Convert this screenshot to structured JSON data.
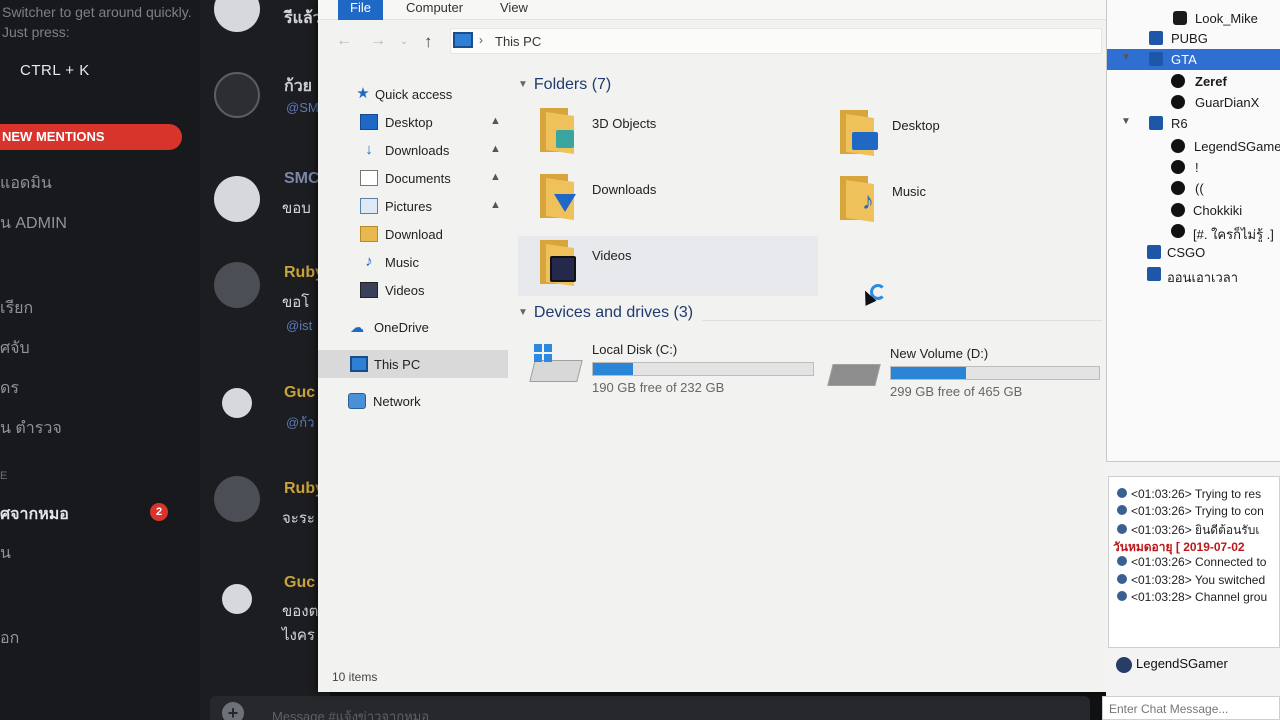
{
  "chat_app": {
    "hint": "Switcher to get around quickly. Just press:",
    "shortcut": "CTRL + K",
    "mentions_label": "NEW MENTIONS",
    "channels": [
      {
        "label": "แอดมิน",
        "bold": false
      },
      {
        "label": "น ADMIN",
        "bold": false
      },
      {
        "label": "เรียก",
        "bold": false
      },
      {
        "label": "ศจับ",
        "bold": false
      },
      {
        "label": "ดร",
        "bold": false
      },
      {
        "label": "น ตำรวจ",
        "bold": false
      },
      {
        "label": "E",
        "bold": false
      },
      {
        "label": "ศจากหมอ",
        "bold": true
      },
      {
        "label": "น",
        "bold": false
      },
      {
        "label": "อก",
        "bold": false
      }
    ],
    "unread_badge": "2",
    "messages": [
      {
        "name": "รีแล้ว",
        "text": "",
        "sub": ""
      },
      {
        "name": "ก้วย",
        "text": "",
        "sub": "@SM"
      },
      {
        "name": "SMC",
        "text": "ขอบ",
        "sub": ""
      },
      {
        "name": "Ruby",
        "text": "ขอโ",
        "sub": "@ist"
      },
      {
        "name": "Guc",
        "text": "",
        "sub": "@ก้ว"
      },
      {
        "name": "Ruby",
        "text": "จะระ",
        "sub": ""
      },
      {
        "name": "Guc",
        "text": "ของต ไงคร",
        "sub": ""
      }
    ],
    "message_placeholder": "Message #แจ้งข่าวจากหมอ"
  },
  "explorer": {
    "ribbon_tabs": [
      "File",
      "Computer",
      "View"
    ],
    "breadcrumb": "This PC",
    "nav": {
      "quick_access": "Quick access",
      "items": [
        {
          "label": "Desktop",
          "icon": "desktop-icon",
          "pinned": true
        },
        {
          "label": "Downloads",
          "icon": "download-arrow-icon",
          "pinned": true
        },
        {
          "label": "Documents",
          "icon": "document-icon",
          "pinned": true
        },
        {
          "label": "Pictures",
          "icon": "pictures-icon",
          "pinned": true
        },
        {
          "label": "Download",
          "icon": "folder-icon",
          "pinned": false
        },
        {
          "label": "Music",
          "icon": "music-note-icon",
          "pinned": false
        },
        {
          "label": "Videos",
          "icon": "film-icon",
          "pinned": false
        }
      ],
      "onedrive": "OneDrive",
      "this_pc": "This PC",
      "network": "Network"
    },
    "folders_header": "Folders (7)",
    "folders": [
      {
        "label": "3D Objects",
        "icon": "3d-cube-icon"
      },
      {
        "label": "Desktop",
        "icon": "desktop-icon"
      },
      {
        "label": "Downloads",
        "icon": "download-arrow-icon"
      },
      {
        "label": "Music",
        "icon": "music-note-icon"
      },
      {
        "label": "Videos",
        "icon": "film-icon"
      }
    ],
    "drives_header": "Devices and drives (3)",
    "drives": [
      {
        "label": "Local Disk (C:)",
        "free": "190 GB free of 232 GB",
        "used_fraction": 0.18
      },
      {
        "label": "New Volume (D:)",
        "free": "299 GB free of 465 GB",
        "used_fraction": 0.36
      }
    ],
    "status": "10 items"
  },
  "teamspeak": {
    "tree": [
      {
        "label": "Look_Mike",
        "type": "user",
        "level": 2
      },
      {
        "label": "PUBG",
        "type": "channel",
        "level": 1
      },
      {
        "label": "GTA",
        "type": "channel",
        "level": 1,
        "selected": true
      },
      {
        "label": "Zeref",
        "type": "client",
        "level": 2
      },
      {
        "label": "GuarDianX",
        "type": "client",
        "level": 2
      },
      {
        "label": "R6",
        "type": "channel",
        "level": 1
      },
      {
        "label": "LegendSGame",
        "type": "client",
        "level": 2
      },
      {
        "label": "!",
        "type": "client",
        "level": 2
      },
      {
        "label": "((",
        "type": "client",
        "level": 2
      },
      {
        "label": "Chokkiki",
        "type": "client",
        "level": 2
      },
      {
        "label": "[#. ใครก็ไม่รู้ .]",
        "type": "client",
        "level": 2
      },
      {
        "label": "CSGO",
        "type": "channel",
        "level": 0
      },
      {
        "label": "ออนเอาเวลา",
        "type": "channel",
        "level": 0
      }
    ],
    "log": [
      {
        "text": "<01:03:26> Trying to res",
        "red": false
      },
      {
        "text": "<01:03:26> Trying to con",
        "red": false
      },
      {
        "text": "<01:03:26> ยินดีต้อนรับเ",
        "red": false
      },
      {
        "text": "วันหมดอายุ [ 2019-07-02",
        "red": true
      },
      {
        "text": "<01:03:26> Connected to",
        "red": false
      },
      {
        "text": "<01:03:28> You switched",
        "red": false
      },
      {
        "text": "<01:03:28> Channel grou",
        "red": false
      }
    ],
    "current_user": "LegendSGamer",
    "chat_placeholder": "Enter Chat Message..."
  },
  "colors": {
    "accent": "#1f68c6",
    "mention": "#d8342c",
    "drive_fill": "#2a85d6",
    "ts_selected": "#2f6fd1"
  }
}
